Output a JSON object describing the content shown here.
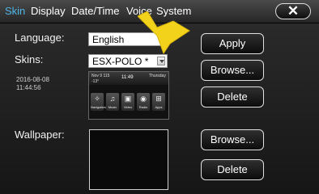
{
  "tabs": [
    {
      "label": "Skin",
      "active": true
    },
    {
      "label": "Display",
      "active": false
    },
    {
      "label": "Date/Time",
      "active": false
    },
    {
      "label": "Voice",
      "active": false
    },
    {
      "label": "System",
      "active": false
    }
  ],
  "close_label": "✕",
  "language": {
    "label": "Language:",
    "value": "English"
  },
  "skins": {
    "label": "Skins:",
    "value": "ESX-POLO *"
  },
  "skin_date": "2016-08-08",
  "skin_time": "11:44:56",
  "preview": {
    "top_left": "Nov 9 115",
    "temp": "-13°",
    "clock": "11:49",
    "top_right": "Thursday",
    "icons": [
      {
        "glyph": "✧",
        "label": "Navigation"
      },
      {
        "glyph": "♫",
        "label": "Music"
      },
      {
        "glyph": "▣",
        "label": "Video"
      },
      {
        "glyph": "◉",
        "label": "Radio"
      },
      {
        "glyph": "⊞",
        "label": "Apps"
      }
    ]
  },
  "wallpaper_label": "Wallpaper:",
  "buttons": {
    "apply": "Apply",
    "browse_skin": "Browse...",
    "delete_skin": "Delete",
    "browse_wallpaper": "Browse...",
    "delete_wallpaper": "Delete"
  },
  "colors": {
    "active_tab": "#4fb6e8",
    "pointer": "#f2d21b"
  }
}
